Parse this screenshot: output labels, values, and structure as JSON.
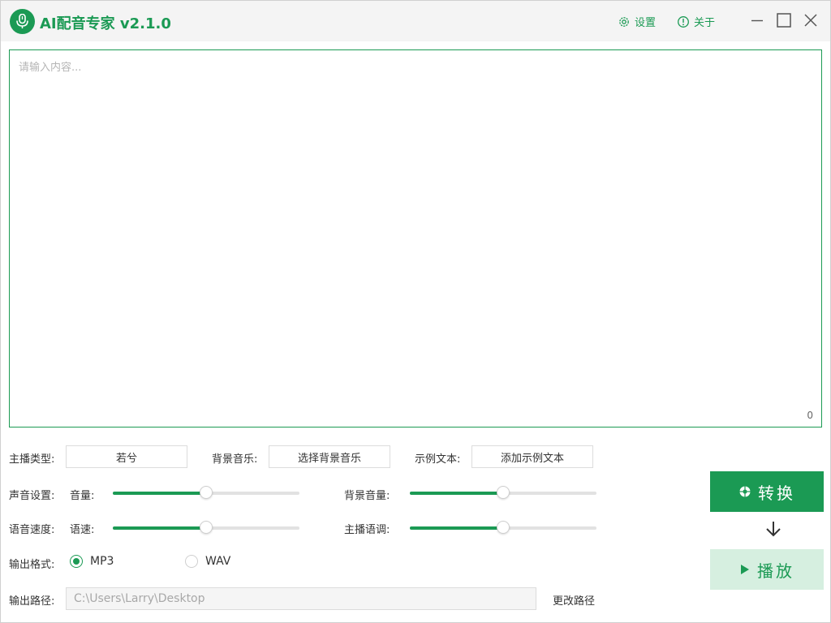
{
  "app": {
    "title": "AI配音专家 v2.1.0"
  },
  "titlebar": {
    "settings_label": "设置",
    "about_label": "关于"
  },
  "editor": {
    "placeholder": "请输入内容...",
    "value": "",
    "char_count": "0"
  },
  "anchor": {
    "label": "主播类型:",
    "value": "若兮"
  },
  "bg_music": {
    "label": "背景音乐:",
    "button_label": "选择背景音乐"
  },
  "sample_text": {
    "label": "示例文本:",
    "button_label": "添加示例文本"
  },
  "voice_settings": {
    "label": "声音设置:",
    "volume": {
      "label": "音量:",
      "value": 0.5
    },
    "bg_volume": {
      "label": "背景音量:",
      "value": 0.5
    }
  },
  "speed_settings": {
    "label": "语音速度:",
    "speed": {
      "label": "语速:",
      "value": 0.5
    },
    "pitch": {
      "label": "主播语调:",
      "value": 0.5
    }
  },
  "output_format": {
    "label": "输出格式:",
    "options": [
      "MP3",
      "WAV"
    ],
    "selected": "MP3"
  },
  "output_path": {
    "label": "输出路径:",
    "value": "C:\\Users\\Larry\\Desktop",
    "change_label": "更改路径"
  },
  "actions": {
    "convert_label": "转换",
    "play_label": "播放"
  },
  "colors": {
    "accent": "#1b9a54",
    "accent_light": "#d6efe0"
  }
}
